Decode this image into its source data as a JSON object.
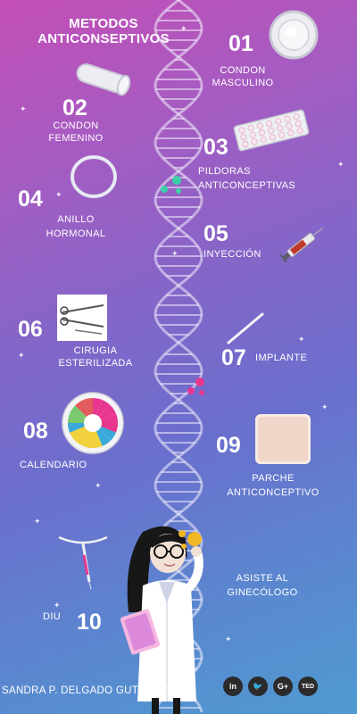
{
  "title": {
    "line1": "METODOS",
    "line2": "ANTICONSEPTIVOS"
  },
  "methods": [
    {
      "number": "01",
      "line1": "CONDON",
      "line2": "MASCULINO"
    },
    {
      "number": "02",
      "line1": "CONDON",
      "line2": "FEMENINO"
    },
    {
      "number": "03",
      "line1": "PILDORAS",
      "line2": "ANTICONCEPTIVAS"
    },
    {
      "number": "04",
      "line1": "ANILLO",
      "line2": "HORMONAL"
    },
    {
      "number": "05",
      "line1": "INYECCIÓN"
    },
    {
      "number": "06",
      "line1": "CIRUGIA",
      "line2": "ESTERILIZADA"
    },
    {
      "number": "07",
      "line1": "IMPLANTE"
    },
    {
      "number": "08",
      "line1": "CALENDARIO"
    },
    {
      "number": "09",
      "line1": "PARCHE",
      "line2": "ANTICONCEPTIVO"
    },
    {
      "number": "10",
      "line1": "DIU"
    }
  ],
  "advice": {
    "line1": "ASISTE AL",
    "line2": "GINECÓLOGO"
  },
  "author": "SANDRA P. DELGADO GUTIERREZ",
  "social": [
    {
      "label": "in",
      "icon": "linkedin-icon"
    },
    {
      "label": "🐦",
      "icon": "twitter-icon"
    },
    {
      "label": "G+",
      "icon": "google-plus-icon"
    },
    {
      "label": "TED",
      "icon": "ted-icon"
    }
  ],
  "colors": {
    "gradient_top": "#c34fb7",
    "gradient_bottom": "#4f9bd0",
    "accent_teal": "#3ad0a8",
    "accent_pink": "#e8368f"
  }
}
